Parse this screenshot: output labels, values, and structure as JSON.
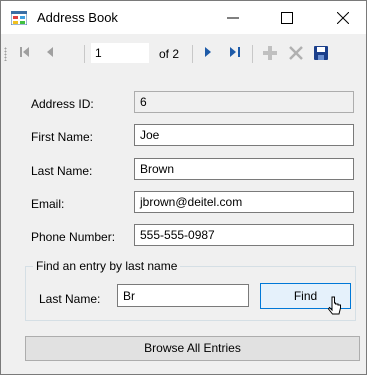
{
  "window": {
    "title": "Address Book",
    "app_icon": "address-book-form-icon"
  },
  "titlebar_buttons": {
    "minimize": "minimize-icon",
    "maximize": "maximize-icon",
    "close": "close-icon"
  },
  "navigator": {
    "position": "1",
    "count_label": "of 2",
    "icons": [
      "move-first-icon",
      "move-previous-icon",
      "move-next-icon",
      "move-last-icon",
      "add-new-icon",
      "delete-icon",
      "save-icon"
    ]
  },
  "fields": {
    "address_id": {
      "label": "Address ID:",
      "value": "6"
    },
    "first_name": {
      "label": "First Name:",
      "value": "Joe"
    },
    "last_name": {
      "label": "Last Name:",
      "value": "Brown"
    },
    "email": {
      "label": "Email:",
      "value": "jbrown@deitel.com"
    },
    "phone": {
      "label": "Phone Number:",
      "value": "555-555-0987"
    }
  },
  "find": {
    "group_title": "Find an entry by last name",
    "label": "Last Name:",
    "value": "Br",
    "button_label": "Find"
  },
  "browse": {
    "button_label": "Browse All Entries"
  },
  "colors": {
    "accent": "#0078d7",
    "nav_blue": "#1e5ba8",
    "disabled_icon": "#a0a0a0"
  }
}
